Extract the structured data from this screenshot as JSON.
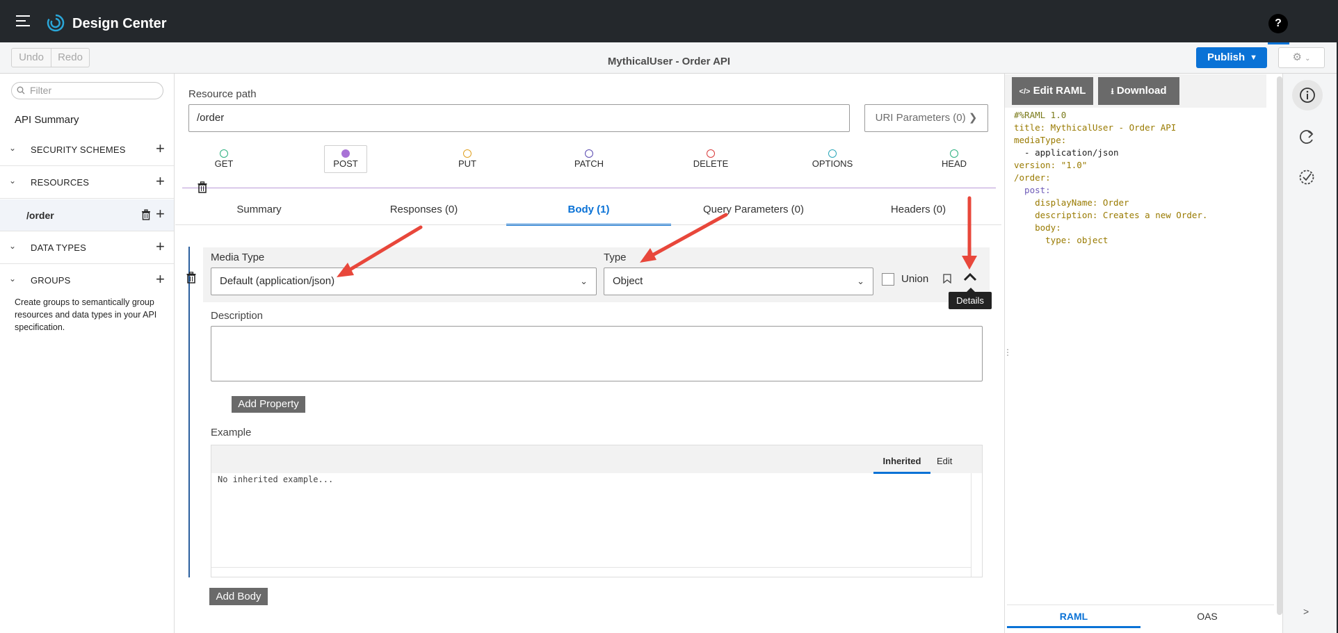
{
  "app": {
    "title": "Design Center",
    "help": "?"
  },
  "toolbar": {
    "undo": "Undo",
    "redo": "Redo",
    "doc_title": "MythicalUser - Order API",
    "publish": "Publish",
    "settings_icon": "gear-icon"
  },
  "sidebar": {
    "filter_placeholder": "Filter",
    "api_summary": "API Summary",
    "sections": [
      {
        "label": "SECURITY SCHEMES"
      },
      {
        "label": "RESOURCES"
      },
      {
        "label": "DATA TYPES"
      },
      {
        "label": "GROUPS"
      }
    ],
    "resource_item": "/order",
    "groups_help": "Create groups to semantically group resources and data types in your API specification."
  },
  "main": {
    "resource_path_label": "Resource path",
    "resource_path": "/order",
    "uri_params": "URI Parameters (0)",
    "methods": [
      {
        "label": "GET",
        "color": "#2bb07f"
      },
      {
        "label": "POST",
        "color": "#a872d6"
      },
      {
        "label": "PUT",
        "color": "#e0a020"
      },
      {
        "label": "PATCH",
        "color": "#5a4ab0"
      },
      {
        "label": "DELETE",
        "color": "#d83a3a"
      },
      {
        "label": "OPTIONS",
        "color": "#2aa6b8"
      },
      {
        "label": "HEAD",
        "color": "#2bb07f"
      }
    ],
    "tabs": [
      {
        "label": "Summary"
      },
      {
        "label": "Responses (0)"
      },
      {
        "label": "Body (1)"
      },
      {
        "label": "Query Parameters (0)"
      },
      {
        "label": "Headers (0)"
      }
    ]
  },
  "body": {
    "media_type_label": "Media Type",
    "media_type_value": "Default (application/json)",
    "type_label": "Type",
    "type_value": "Object",
    "union_label": "Union",
    "tooltip": "Details",
    "description_label": "Description",
    "add_property": "Add Property",
    "example_label": "Example",
    "example_tab_inherited": "Inherited",
    "example_tab_edit": "Edit",
    "example_text": "No inherited example...",
    "add_body": "Add Body"
  },
  "raml": {
    "edit_raml": "Edit RAML",
    "download": "Download",
    "lines": [
      "#%RAML 1.0",
      "title: MythicalUser - Order API",
      "mediaType:",
      "  - application/json",
      "version: \"1.0\"",
      "/order:",
      "  post:",
      "    displayName: Order",
      "    description: Creates a new Order.",
      "    body:",
      "      type: object"
    ],
    "tab_raml": "RAML",
    "tab_oas": "OAS"
  },
  "rail": {
    "collapse": ">"
  },
  "colors": {
    "accent": "#0a72d6",
    "annotation_arrow": "#e8473b"
  }
}
